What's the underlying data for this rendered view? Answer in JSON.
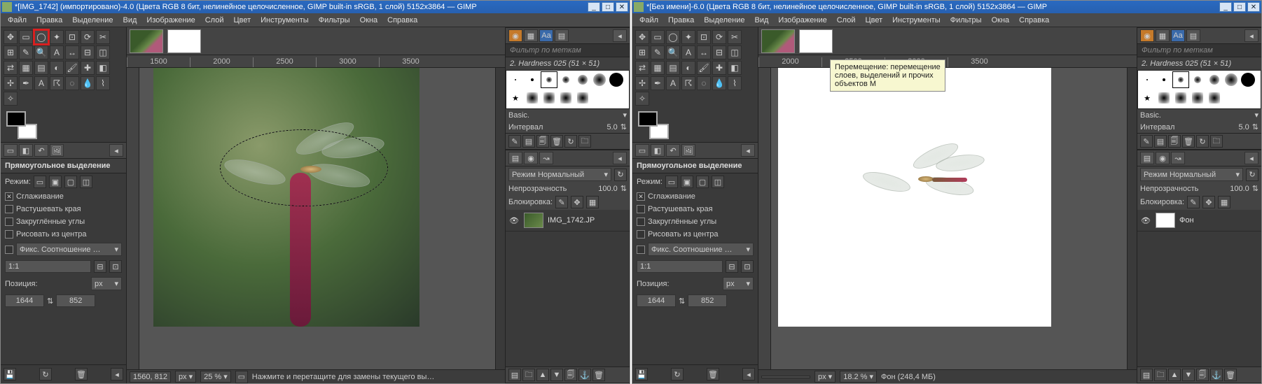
{
  "left": {
    "title": "*[IMG_1742] (импортировано)-4.0 (Цвета RGB 8 бит, нелинейное целочисленное, GIMP built-in sRGB, 1 слой) 5152x3864 — GIMP",
    "menus": [
      "Файл",
      "Правка",
      "Выделение",
      "Вид",
      "Изображение",
      "Слой",
      "Цвет",
      "Инструменты",
      "Фильтры",
      "Окна",
      "Справка"
    ],
    "tool_options_title": "Прямоугольное выделение",
    "mode_label": "Режим:",
    "antialias": "Сглаживание",
    "feather": "Растушевать края",
    "rounded": "Закруглённые углы",
    "from_center": "Рисовать из центра",
    "fixed_label": "Фикс. Соотношение …",
    "ratio": "1:1",
    "pos_label": "Позиция:",
    "pos_x": "1644",
    "pos_y": "852",
    "unit": "px",
    "filter_placeholder": "Фильтр по меткам",
    "brush_name": "2. Hardness 025 (51 × 51)",
    "brush_preset": "Basic.",
    "interval_label": "Интервал",
    "interval_value": "5.0",
    "mode_normal": "Режим  Нормальный",
    "opacity_label": "Непрозрачность",
    "opacity_value": "100.0",
    "lock_label": "Блокировка:",
    "layer_name": "IMG_1742.JP",
    "status_coords": "1560, 812",
    "status_unit": "px",
    "status_zoom": "25 %",
    "status_msg": "Нажмите и перетащите для замены текущего вы…",
    "ruler_ticks": [
      "1500",
      "2000",
      "2500",
      "3000",
      "3500"
    ]
  },
  "right": {
    "title": "*[Без имени]-6.0 (Цвета RGB 8 бит, нелинейное целочисленное, GIMP built-in sRGB, 1 слой) 5152x3864 — GIMP",
    "menus": [
      "Файл",
      "Правка",
      "Выделение",
      "Вид",
      "Изображение",
      "Слой",
      "Цвет",
      "Инструменты",
      "Фильтры",
      "Окна",
      "Справка"
    ],
    "tool_options_title": "Прямоугольное выделение",
    "mode_label": "Режим:",
    "antialias": "Сглаживание",
    "feather": "Растушевать края",
    "rounded": "Закруглённые углы",
    "from_center": "Рисовать из центра",
    "fixed_label": "Фикс. Соотношение …",
    "ratio": "1:1",
    "pos_label": "Позиция:",
    "pos_x": "1644",
    "pos_y": "852",
    "unit": "px",
    "filter_placeholder": "Фильтр по меткам",
    "brush_name": "2. Hardness 025 (51 × 51)",
    "brush_preset": "Basic.",
    "interval_label": "Интервал",
    "interval_value": "5.0",
    "mode_normal": "Режим  Нормальный",
    "opacity_label": "Непрозрачность",
    "opacity_value": "100.0",
    "lock_label": "Блокировка:",
    "layer_name": "Фон",
    "status_unit": "px",
    "status_zoom": "18.2 %",
    "status_size": "Фон (248,4 МБ)",
    "tooltip_line1": "Перемещение: перемещение",
    "tooltip_line2": "слоев, выделений и прочих",
    "tooltip_line3": "объектов  M",
    "ruler_ticks": [
      "2000",
      "2500",
      "3000",
      "3500"
    ]
  }
}
